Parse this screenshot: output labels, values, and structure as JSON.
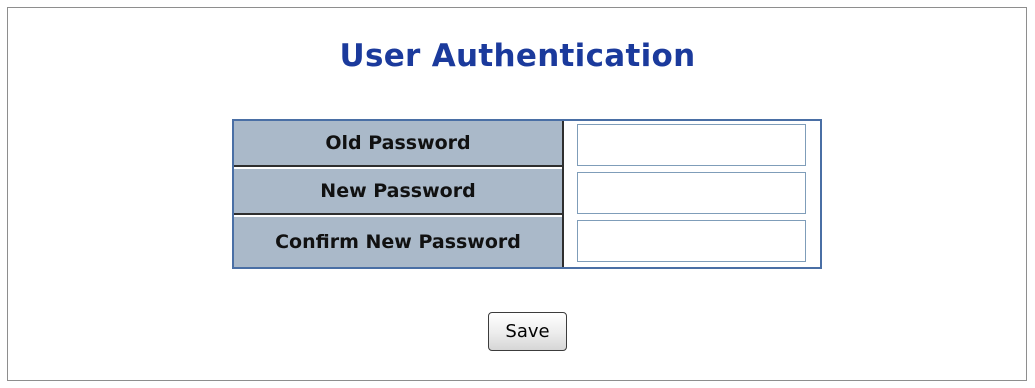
{
  "page": {
    "title": "User Authentication"
  },
  "form": {
    "fields": [
      {
        "label": "Old Password",
        "value": ""
      },
      {
        "label": "New Password",
        "value": ""
      },
      {
        "label": "Confirm New Password",
        "value": ""
      }
    ],
    "save_label": "Save"
  },
  "colors": {
    "title": "#1b3a9c",
    "label_bg": "#aab9c9",
    "form_border": "#4a6fa5"
  }
}
